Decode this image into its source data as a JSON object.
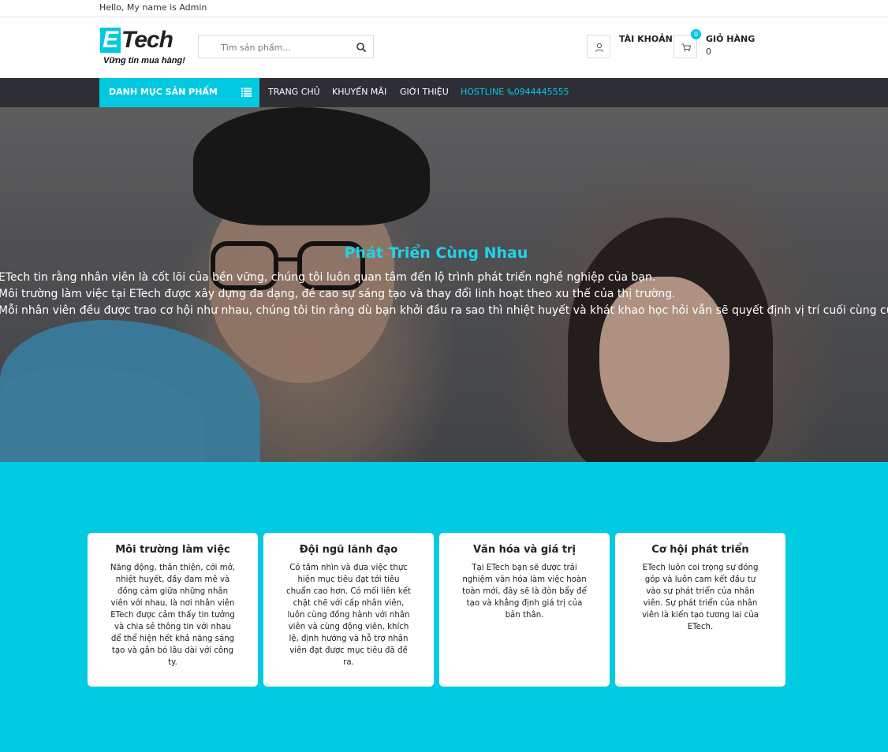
{
  "topbar": {
    "greeting": "Hello, My name is Admin"
  },
  "header": {
    "logo": {
      "mark": "E",
      "word": "Tech",
      "tagline": "Vững tin mua hàng!"
    },
    "search": {
      "placeholder": "Tìm sản phẩm...",
      "icon": "search-icon"
    },
    "account": {
      "label": "TÀI KHOẢN",
      "icon": "user-icon"
    },
    "cart": {
      "label": "GIỎ HÀNG",
      "count": "0",
      "badge": "0",
      "icon": "cart-icon"
    }
  },
  "nav": {
    "category_label": "DANH MỤC SẢN PHẨM",
    "category_icon": "list-icon",
    "links": [
      "TRANG CHỦ",
      "KHUYẾN MÃI",
      "GIỚI THIỆU"
    ],
    "hotline_label": "HOSTLINE",
    "hotline_icon": "phone-icon",
    "hotline_number": "0944445555"
  },
  "hero": {
    "title": "Phát Triển Cùng Nhau",
    "lines": [
      "ETech tin rằng nhân viên là cốt lõi của bền vững, chúng tôi luôn quan tâm đến lộ trình phát triển nghề nghiệp của bạn.",
      "Môi trường làm việc tại ETech được xây dựng đa dạng, đề cao sự sáng tạo và thay đổi linh hoạt theo xu thế của thị trường.",
      "Mỗi nhân viên đều được trao cơ hội như nhau, chúng tôi tin rằng dù bạn khởi đầu ra sao thì nhiệt huyết và khát khao học hỏi vẫn sẽ quyết định vị trí cuối cùng của bạn."
    ]
  },
  "values": [
    {
      "title": "Môi trường làm việc",
      "text": "Năng động, thân thiện, cởi mở, nhiệt huyết, đầy đam mê và đồng cảm giữa những nhân viên với nhau, là nơi nhân viên ETech được cảm thấy tin tưởng và chia sẻ thông tin với nhau để thể hiện hết khả năng sáng tạo và gắn bó lâu dài với công ty."
    },
    {
      "title": "Đội ngũ lãnh đạo",
      "text": "Có tầm nhìn và đưa việc thực hiện mục tiêu đạt tới tiêu chuẩn cao hơn. Có mối liên kết chặt chẽ với cấp nhân viên, luôn cùng đồng hành với nhân viên và cùng động viên, khích lệ, định hướng và hỗ trợ nhân viên đạt được mục tiêu đã đề ra."
    },
    {
      "title": "Văn hóa và giá trị",
      "text": "Tại ETech bạn sẽ được trải nghiệm văn hóa làm việc hoàn toàn mới, đây sẽ là đòn bẩy để tạo và khẳng định giá trị của bản thân."
    },
    {
      "title": "Cơ hội phát triển",
      "text": "ETech luôn coi trọng sự đóng góp và luôn cam kết đầu tư vào sự phát triển của nhân viên. Sự phát triển của nhân viên là kiến tạo tương lai của ETech."
    }
  ],
  "colors": {
    "accent": "#00c9e0",
    "nav_bg": "#2e2f36",
    "section_bg": "#00cbe0"
  }
}
